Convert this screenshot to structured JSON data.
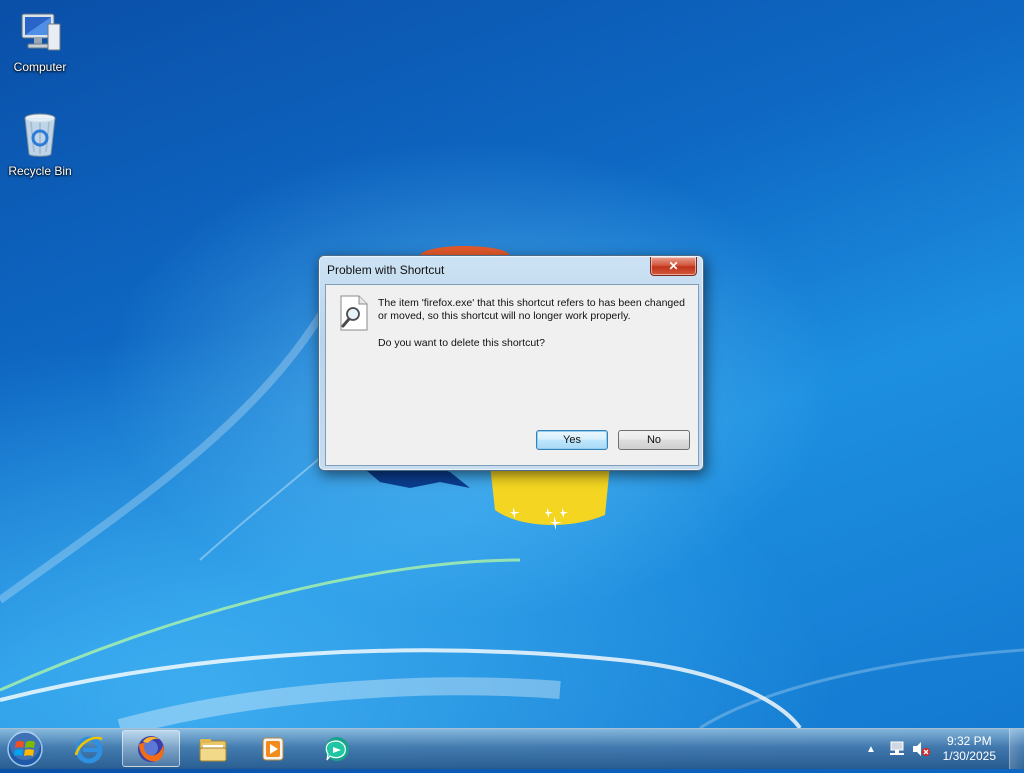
{
  "desktop": {
    "icons": [
      {
        "label": "Computer",
        "icon": "computer-icon"
      },
      {
        "label": "Recycle Bin",
        "icon": "recycle-bin-icon"
      }
    ]
  },
  "dialog": {
    "title": "Problem with Shortcut",
    "close_label": "✕",
    "message": "The item 'firefox.exe' that this shortcut refers to has been changed or moved, so this shortcut will no longer work properly.",
    "question": "Do you want to delete this shortcut?",
    "yes_label": "Yes",
    "no_label": "No"
  },
  "taskbar": {
    "items": [
      {
        "name": "internet-explorer-icon"
      },
      {
        "name": "firefox-icon",
        "active": true
      },
      {
        "name": "file-explorer-icon"
      },
      {
        "name": "media-player-icon"
      },
      {
        "name": "messenger-icon"
      }
    ],
    "time": "9:32 PM",
    "date": "1/30/2025"
  },
  "colors": {
    "desktop_blue": "#0e69c4",
    "dialog_frame": "#b9d3ea",
    "close_red": "#c0341a",
    "default_button": "#bee6fd"
  }
}
